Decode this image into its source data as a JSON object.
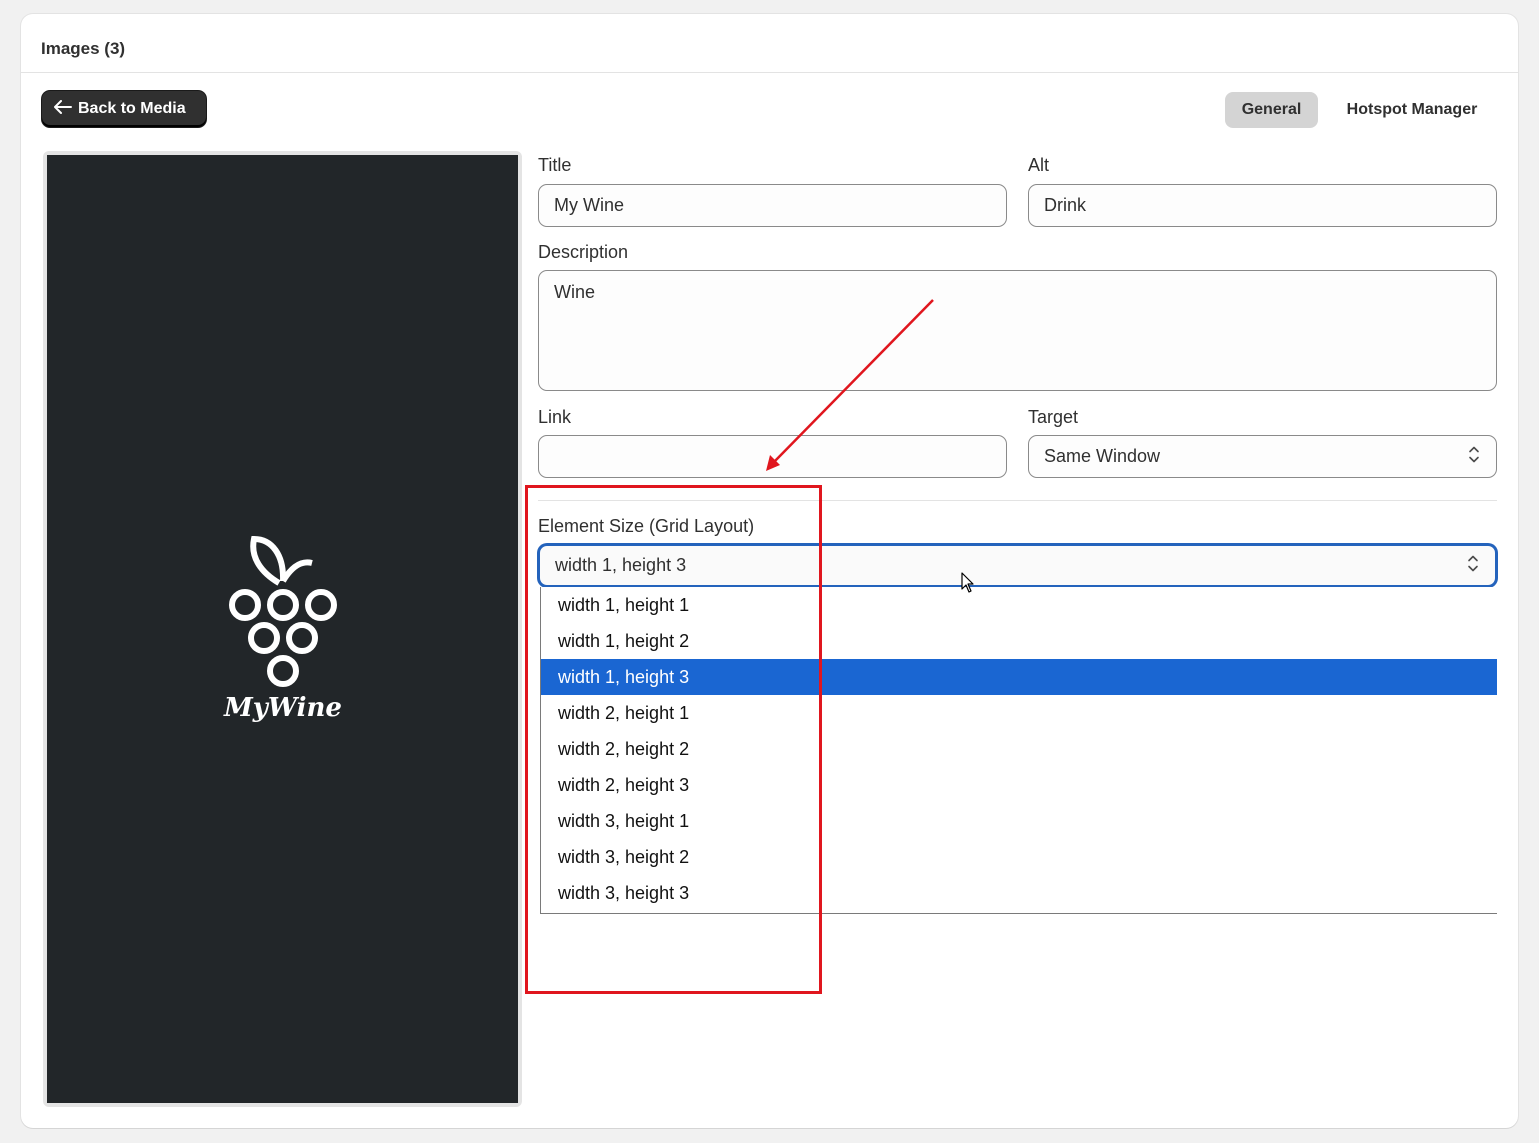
{
  "header": {
    "title": "Images (3)"
  },
  "toolbar": {
    "back_label": "Back to Media"
  },
  "tabs": [
    {
      "label": "General",
      "active": true
    },
    {
      "label": "Hotspot Manager",
      "active": false
    }
  ],
  "preview": {
    "logo_text": "MyWine",
    "background": "#222629"
  },
  "form": {
    "title": {
      "label": "Title",
      "value": "My Wine"
    },
    "alt": {
      "label": "Alt",
      "value": "Drink"
    },
    "description": {
      "label": "Description",
      "value": "Wine"
    },
    "link": {
      "label": "Link",
      "value": ""
    },
    "target": {
      "label": "Target",
      "value": "Same Window"
    },
    "element_size": {
      "label": "Element Size (Grid Layout)",
      "value": "width 1, height 3",
      "options": [
        "width 1, height 1",
        "width 1, height 2",
        "width 1, height 3",
        "width 2, height 1",
        "width 2, height 2",
        "width 2, height 3",
        "width 3, height 1",
        "width 3, height 2",
        "width 3, height 3"
      ],
      "selected_index": 2
    }
  },
  "colors": {
    "accent": "#1a66d2",
    "annotation": "#e0161e",
    "dark_button": "#303030"
  }
}
